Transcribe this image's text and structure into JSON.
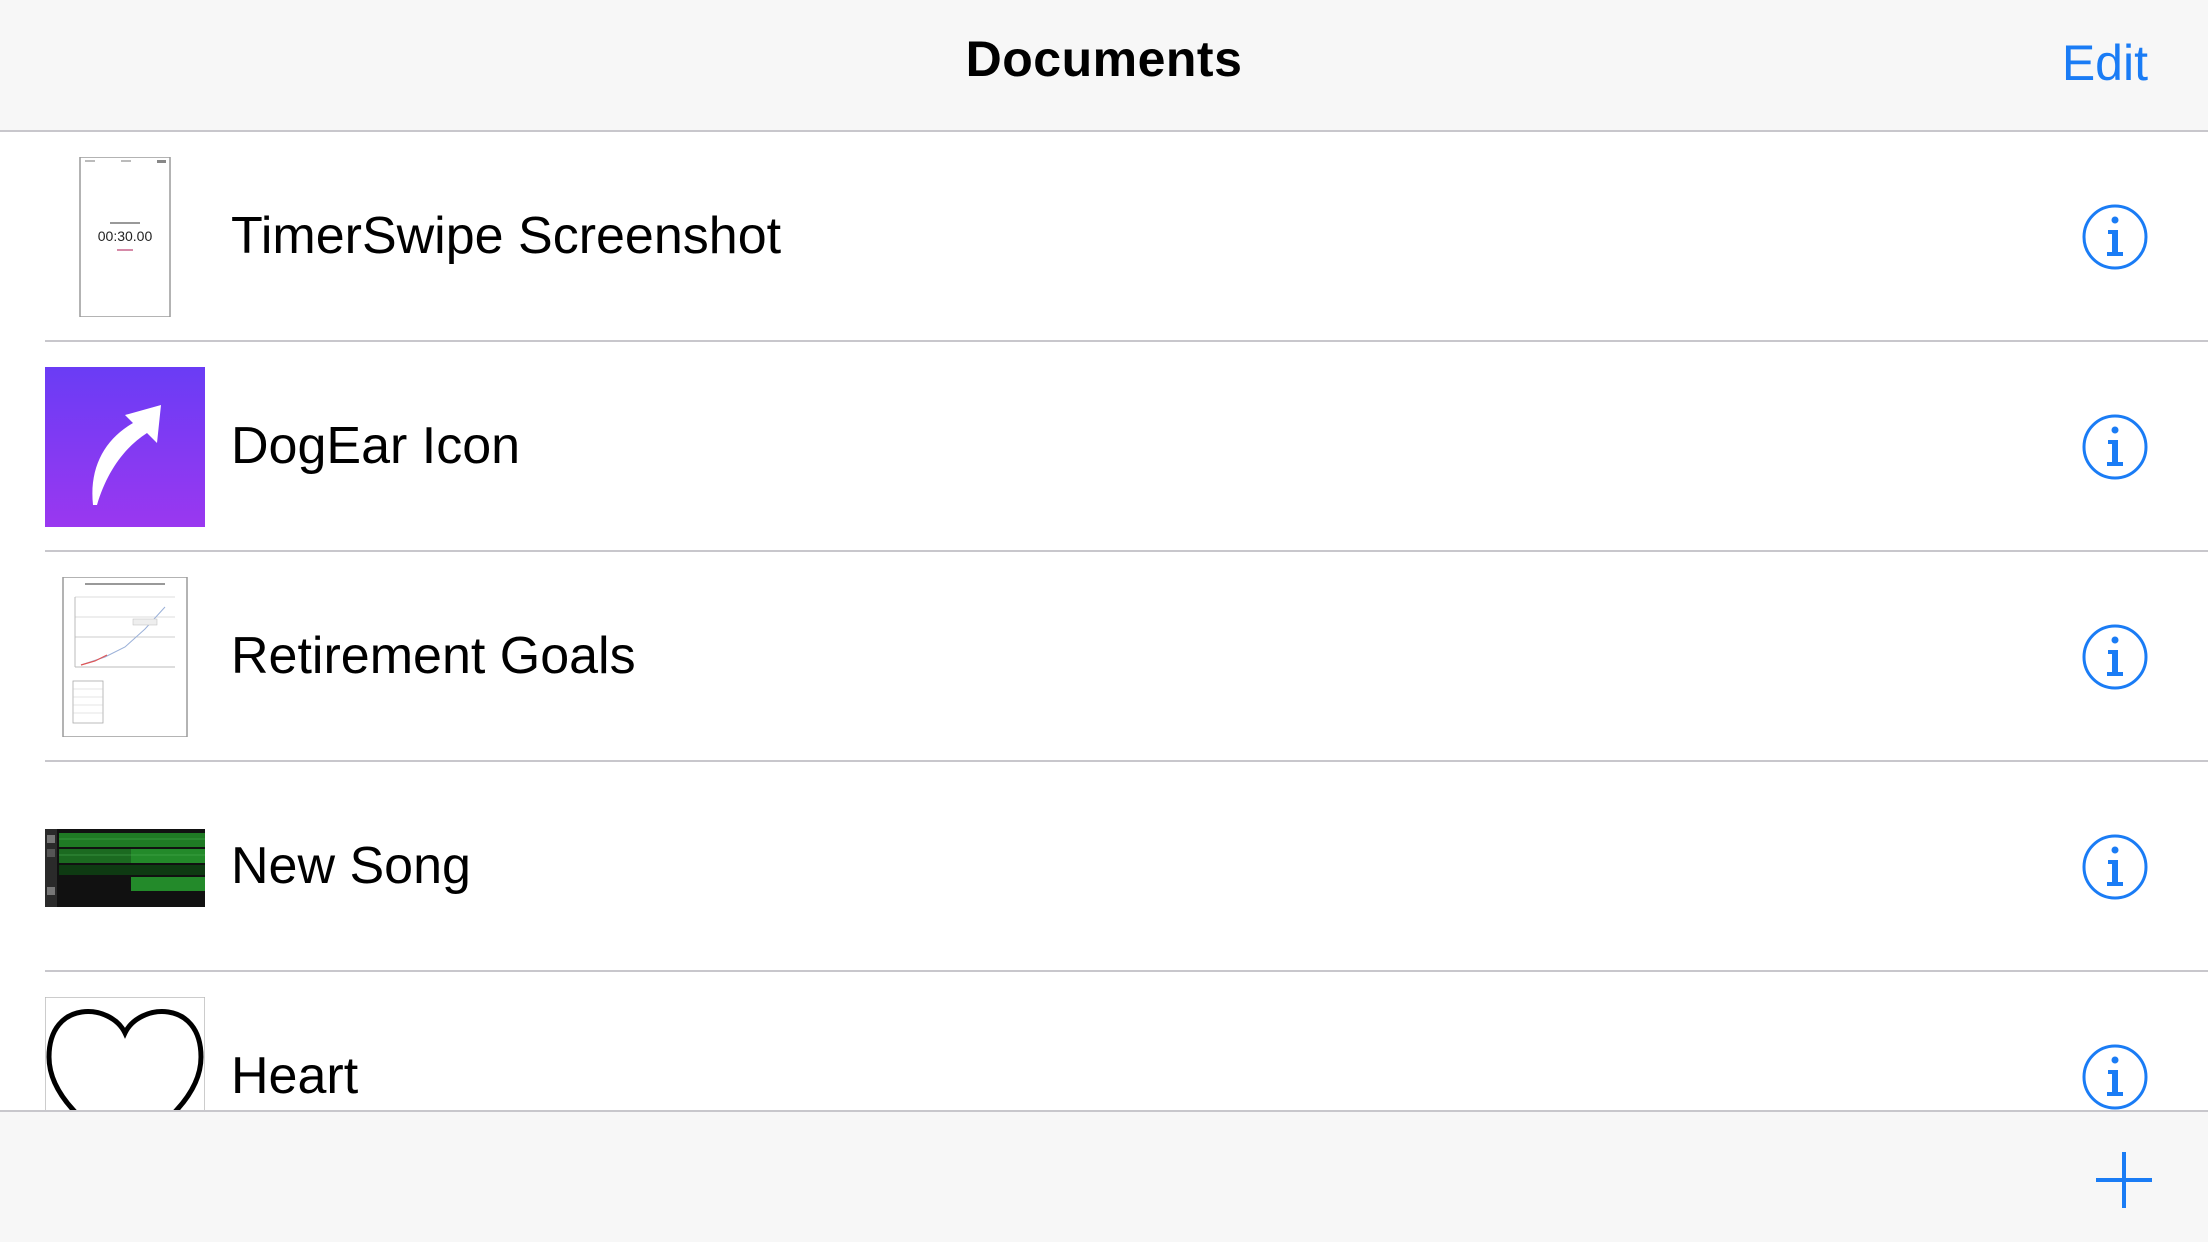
{
  "navbar": {
    "title": "Documents",
    "edit_label": "Edit"
  },
  "documents": [
    {
      "name": "TimerSwipe Screenshot",
      "thumb_text": "00:30.00",
      "icon": "document-thumbnail"
    },
    {
      "name": "DogEar Icon",
      "icon": "curved-arrow-icon"
    },
    {
      "name": "Retirement Goals",
      "icon": "spreadsheet-thumbnail"
    },
    {
      "name": "New Song",
      "icon": "music-tracks-thumbnail"
    },
    {
      "name": "Heart",
      "icon": "heart-icon"
    }
  ],
  "toolbar": {
    "add_icon": "plus-icon"
  },
  "colors": {
    "accent": "#1a7cf5",
    "bar_bg": "#f7f7f7",
    "separator": "#c8c7cc",
    "dogear_top": "#6a3cf5",
    "dogear_bottom": "#9a38f0",
    "song_green": "#1f7a24"
  }
}
